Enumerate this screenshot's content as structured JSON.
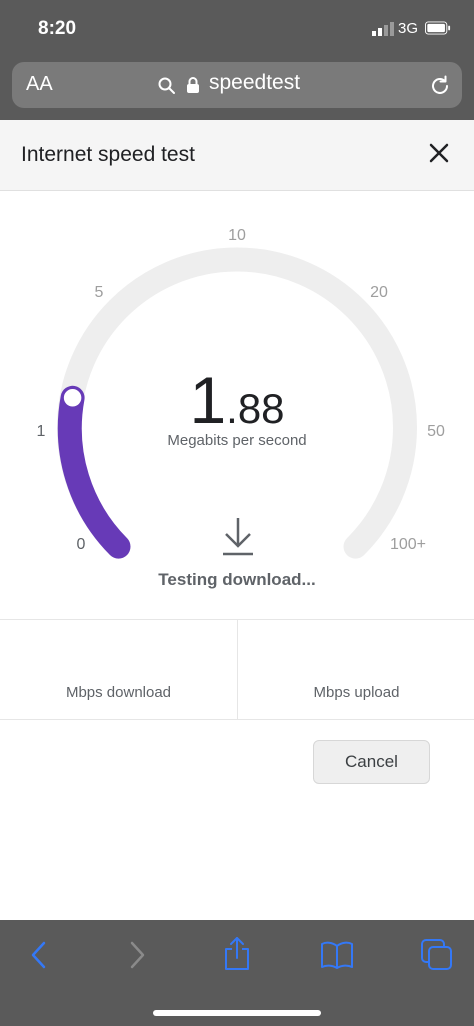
{
  "status_bar": {
    "time": "8:20",
    "network": "3G"
  },
  "browser": {
    "text_size_label": "AA",
    "url": "speedtest"
  },
  "dialog": {
    "title": "Internet speed test"
  },
  "gauge": {
    "scale_labels": [
      "0",
      "1",
      "5",
      "10",
      "20",
      "50",
      "100+"
    ],
    "speed_int": "1",
    "speed_dec": ".88",
    "unit": "Megabits per second",
    "status": "Testing download...",
    "accent_color": "#673ab7",
    "track_color": "#eeeeee"
  },
  "results": {
    "download_label": "Mbps download",
    "upload_label": "Mbps upload"
  },
  "cancel_label": "Cancel",
  "toolbar": {
    "icons": [
      "back-icon",
      "forward-icon",
      "share-icon",
      "bookmarks-icon",
      "tabs-icon"
    ],
    "accent_color": "#3478f6"
  }
}
